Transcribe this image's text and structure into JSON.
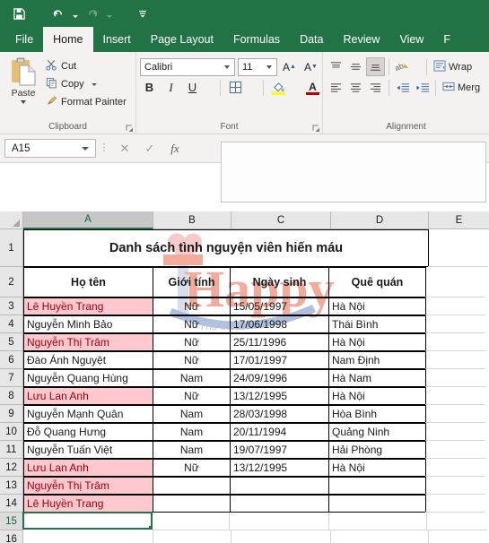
{
  "quick_access": {
    "items": [
      {
        "name": "save",
        "icon": "save-icon"
      },
      {
        "name": "undo",
        "icon": "undo-icon",
        "has_dropdown": true,
        "enabled": true
      },
      {
        "name": "redo",
        "icon": "redo-icon",
        "has_dropdown": true,
        "enabled": false
      },
      {
        "name": "customize",
        "icon": "customize-quick-access-icon"
      }
    ]
  },
  "ribbon": {
    "tabs": [
      {
        "label": "File",
        "active": false
      },
      {
        "label": "Home",
        "active": true
      },
      {
        "label": "Insert",
        "active": false
      },
      {
        "label": "Page Layout",
        "active": false
      },
      {
        "label": "Formulas",
        "active": false
      },
      {
        "label": "Data",
        "active": false
      },
      {
        "label": "Review",
        "active": false
      },
      {
        "label": "View",
        "active": false
      },
      {
        "label": "F",
        "active": false
      }
    ],
    "clipboard": {
      "group_label": "Clipboard",
      "paste_label": "Paste",
      "cut_label": "Cut",
      "copy_label": "Copy",
      "format_painter_label": "Format Painter"
    },
    "font": {
      "group_label": "Font",
      "font_name": "Calibri",
      "font_size": "11",
      "grow_font": "A",
      "shrink_font": "A",
      "bold": "B",
      "italic": "I",
      "underline": "U",
      "fill_color_hex": "#ffff00",
      "font_color_hex": "#c00000"
    },
    "alignment": {
      "group_label": "Alignment",
      "wrap_text_label": "Wrap",
      "merge_label": "Merg"
    }
  },
  "formula_bar": {
    "name_box_value": "A15",
    "cancel_icon": "close-icon",
    "enter_icon": "check-icon",
    "function_icon": "fx-icon",
    "formula_value": ""
  },
  "sheet": {
    "columns": [
      {
        "label": "A",
        "width": 145,
        "selected": true
      },
      {
        "label": "B",
        "width": 87,
        "selected": false
      },
      {
        "label": "C",
        "width": 111,
        "selected": false
      },
      {
        "label": "D",
        "width": 109,
        "selected": false
      },
      {
        "label": "E",
        "width": 67,
        "selected": false
      }
    ],
    "rows": [
      {
        "number": "1",
        "height": 42,
        "type": "title",
        "cells": [
          {
            "value": "Danh sách tình nguyện viên hiến máu",
            "style": "title",
            "colspan": 4,
            "bordered": true
          },
          {
            "value": "",
            "style": "plain",
            "bordered": false
          }
        ]
      },
      {
        "number": "2",
        "height": 34,
        "type": "header",
        "cells": [
          {
            "value": "Họ tên",
            "style": "hdr",
            "bordered": true
          },
          {
            "value": "Giới tính",
            "style": "hdr",
            "bordered": true
          },
          {
            "value": "Ngày sinh",
            "style": "hdr",
            "bordered": true
          },
          {
            "value": "Quê quán",
            "style": "hdr",
            "bordered": true
          },
          {
            "value": "",
            "style": "plain",
            "bordered": false
          }
        ]
      },
      {
        "number": "3",
        "height": 20,
        "type": "data",
        "cells": [
          {
            "value": "Lê Huyền Trang",
            "style": "dup",
            "bordered": true
          },
          {
            "value": "Nữ",
            "style": "ctr",
            "bordered": true
          },
          {
            "value": "15/05/1997",
            "style": "plain",
            "bordered": true
          },
          {
            "value": "Hà Nội",
            "style": "plain",
            "bordered": true
          },
          {
            "value": "",
            "style": "plain",
            "bordered": false
          }
        ]
      },
      {
        "number": "4",
        "height": 20,
        "type": "data",
        "cells": [
          {
            "value": "Nguyễn Minh Bảo",
            "style": "plain",
            "bordered": true
          },
          {
            "value": "Nữ",
            "style": "ctr",
            "bordered": true
          },
          {
            "value": "17/06/1998",
            "style": "plain",
            "bordered": true
          },
          {
            "value": "Thái Bình",
            "style": "plain",
            "bordered": true
          },
          {
            "value": "",
            "style": "plain",
            "bordered": false
          }
        ]
      },
      {
        "number": "5",
        "height": 20,
        "type": "data",
        "cells": [
          {
            "value": "Nguyễn Thị Trâm",
            "style": "dup",
            "bordered": true
          },
          {
            "value": "Nữ",
            "style": "ctr",
            "bordered": true
          },
          {
            "value": "25/11/1996",
            "style": "plain",
            "bordered": true
          },
          {
            "value": "Hà Nội",
            "style": "plain",
            "bordered": true
          },
          {
            "value": "",
            "style": "plain",
            "bordered": false
          }
        ]
      },
      {
        "number": "6",
        "height": 20,
        "type": "data",
        "cells": [
          {
            "value": " Đào Ánh Nguyệt",
            "style": "plain",
            "bordered": true
          },
          {
            "value": "Nữ",
            "style": "ctr",
            "bordered": true
          },
          {
            "value": "17/01/1997",
            "style": "plain",
            "bordered": true
          },
          {
            "value": "Nam Định",
            "style": "plain",
            "bordered": true
          },
          {
            "value": "",
            "style": "plain",
            "bordered": false
          }
        ]
      },
      {
        "number": "7",
        "height": 20,
        "type": "data",
        "cells": [
          {
            "value": "Nguyễn Quang Hùng",
            "style": "plain",
            "bordered": true
          },
          {
            "value": "Nam",
            "style": "ctr",
            "bordered": true
          },
          {
            "value": "24/09/1996",
            "style": "plain",
            "bordered": true
          },
          {
            "value": "Hà Nam",
            "style": "plain",
            "bordered": true
          },
          {
            "value": "",
            "style": "plain",
            "bordered": false
          }
        ]
      },
      {
        "number": "8",
        "height": 20,
        "type": "data",
        "cells": [
          {
            "value": "Lưu Lan Anh",
            "style": "dup",
            "bordered": true
          },
          {
            "value": "Nữ",
            "style": "ctr",
            "bordered": true
          },
          {
            "value": "13/12/1995",
            "style": "plain",
            "bordered": true
          },
          {
            "value": "Hà Nội",
            "style": "plain",
            "bordered": true
          },
          {
            "value": "",
            "style": "plain",
            "bordered": false
          }
        ]
      },
      {
        "number": "9",
        "height": 20,
        "type": "data",
        "cells": [
          {
            "value": "Nguyễn Mạnh Quân",
            "style": "plain",
            "bordered": true
          },
          {
            "value": "Nam",
            "style": "ctr",
            "bordered": true
          },
          {
            "value": "28/03/1998",
            "style": "plain",
            "bordered": true
          },
          {
            "value": "Hòa Bình",
            "style": "plain",
            "bordered": true
          },
          {
            "value": "",
            "style": "plain",
            "bordered": false
          }
        ]
      },
      {
        "number": "10",
        "height": 20,
        "type": "data",
        "cells": [
          {
            "value": "Đỗ Quang Hưng",
            "style": "plain",
            "bordered": true
          },
          {
            "value": "Nam",
            "style": "ctr",
            "bordered": true
          },
          {
            "value": "20/11/1994",
            "style": "plain",
            "bordered": true
          },
          {
            "value": "Quảng Ninh",
            "style": "plain",
            "bordered": true
          },
          {
            "value": "",
            "style": "plain",
            "bordered": false
          }
        ]
      },
      {
        "number": "11",
        "height": 20,
        "type": "data",
        "cells": [
          {
            "value": "Nguyễn Tuấn Việt",
            "style": "plain",
            "bordered": true
          },
          {
            "value": "Nam",
            "style": "ctr",
            "bordered": true
          },
          {
            "value": "19/07/1997",
            "style": "plain",
            "bordered": true
          },
          {
            "value": "Hải Phòng",
            "style": "plain",
            "bordered": true
          },
          {
            "value": "",
            "style": "plain",
            "bordered": false
          }
        ]
      },
      {
        "number": "12",
        "height": 20,
        "type": "data",
        "cells": [
          {
            "value": "Lưu Lan Anh",
            "style": "dup",
            "bordered": true
          },
          {
            "value": "Nữ",
            "style": "ctr",
            "bordered": true
          },
          {
            "value": "13/12/1995",
            "style": "plain",
            "bordered": true
          },
          {
            "value": "Hà Nội",
            "style": "plain",
            "bordered": true
          },
          {
            "value": "",
            "style": "plain",
            "bordered": false
          }
        ]
      },
      {
        "number": "13",
        "height": 20,
        "type": "data",
        "cells": [
          {
            "value": "Nguyễn Thị Trâm",
            "style": "dup",
            "bordered": true
          },
          {
            "value": "",
            "style": "plain",
            "bordered": true
          },
          {
            "value": "",
            "style": "plain",
            "bordered": true
          },
          {
            "value": "",
            "style": "plain",
            "bordered": true
          },
          {
            "value": "",
            "style": "plain",
            "bordered": false
          }
        ]
      },
      {
        "number": "14",
        "height": 20,
        "type": "data",
        "cells": [
          {
            "value": "Lê Huyền Trang",
            "style": "dup",
            "bordered": true
          },
          {
            "value": "",
            "style": "plain",
            "bordered": true
          },
          {
            "value": "",
            "style": "plain",
            "bordered": true
          },
          {
            "value": "",
            "style": "plain",
            "bordered": true
          },
          {
            "value": "",
            "style": "plain",
            "bordered": false
          }
        ]
      },
      {
        "number": "15",
        "height": 20,
        "type": "data",
        "row_selected": true,
        "cells": [
          {
            "value": "",
            "style": "selcell",
            "bordered": false
          },
          {
            "value": "",
            "style": "plain",
            "bordered": false
          },
          {
            "value": "",
            "style": "plain",
            "bordered": false
          },
          {
            "value": "",
            "style": "plain",
            "bordered": false
          },
          {
            "value": "",
            "style": "plain",
            "bordered": false
          }
        ]
      },
      {
        "number": "16",
        "height": 20,
        "type": "data",
        "cells": [
          {
            "value": "",
            "style": "plain",
            "bordered": false
          },
          {
            "value": "",
            "style": "plain",
            "bordered": false
          },
          {
            "value": "",
            "style": "plain",
            "bordered": false
          },
          {
            "value": "",
            "style": "plain",
            "bordered": false
          },
          {
            "value": "",
            "style": "plain",
            "bordered": false
          }
        ]
      }
    ],
    "selected_cell": "A15",
    "duplicate_highlight": {
      "background_hex": "#ffc7ce",
      "text_hex": "#9c0006"
    }
  },
  "watermark": {
    "text": "Happy",
    "subtext": "Thủ thuật",
    "heart_color_hex": "#f2a0a0",
    "text_color_hex": "#e8684a",
    "swoosh_color_hex": "#6b8fc4"
  },
  "theme": {
    "excel_green_hex": "#217346",
    "ribbon_bg_hex": "#f3f2f1"
  }
}
